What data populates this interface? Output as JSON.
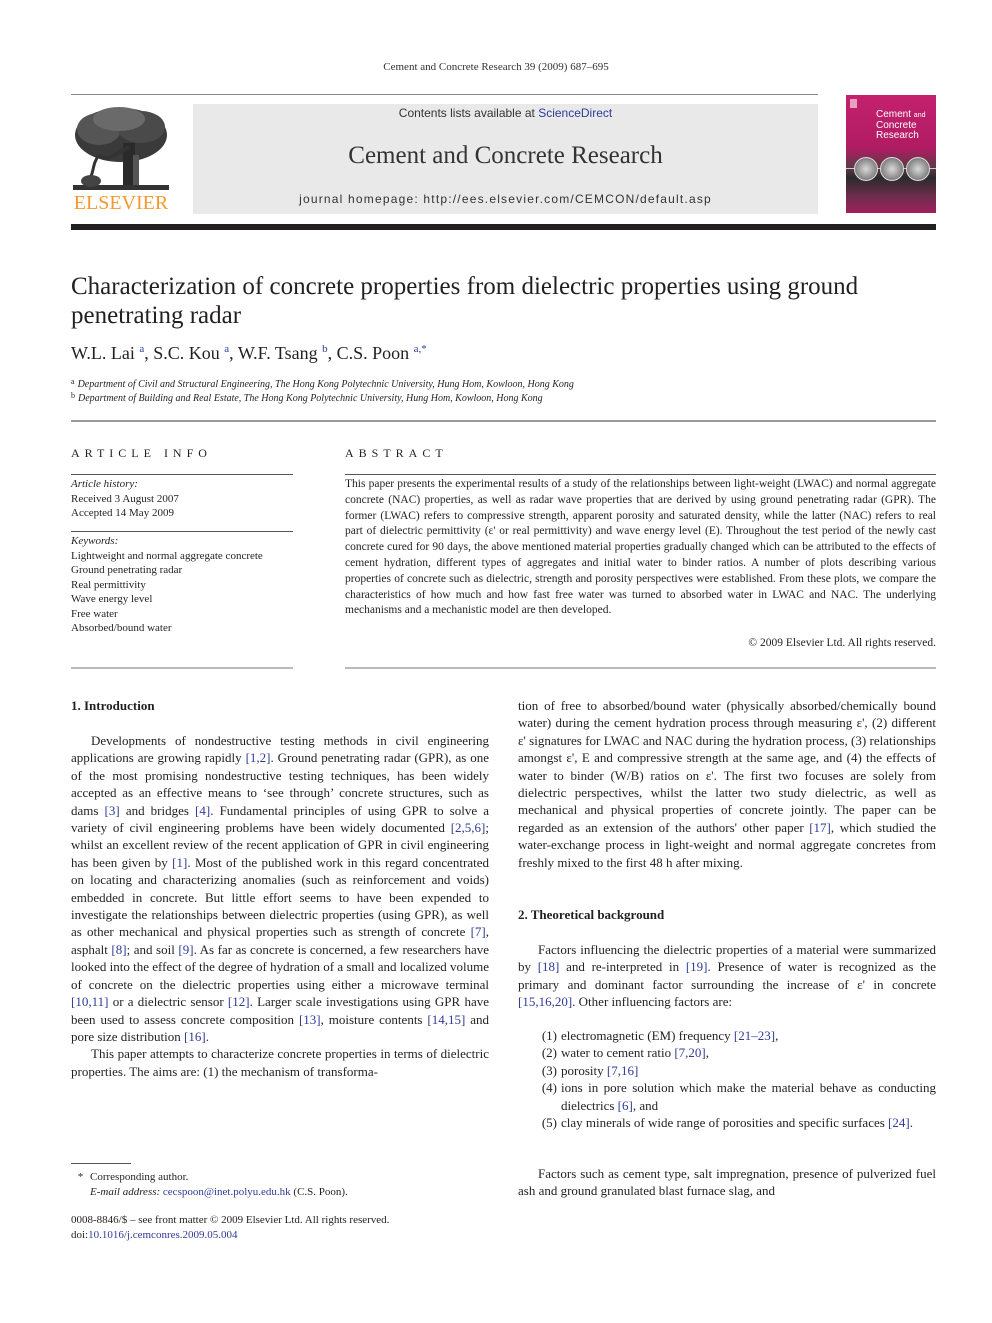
{
  "running_header": "Cement and Concrete Research 39 (2009) 687–695",
  "masthead": {
    "contents_prefix": "Contents lists available at ",
    "contents_link": "ScienceDirect",
    "journal_title": "Cement and Concrete Research",
    "homepage": "journal homepage: http://ees.elsevier.com/CEMCON/default.asp",
    "publisher": "ELSEVIER",
    "cover_title_line1": "Cement",
    "cover_title_and": "and",
    "cover_title_line2": "Concrete",
    "cover_title_line3": "Research"
  },
  "colors": {
    "link": "#2f3b96",
    "publisher_orange": "#f39a2e",
    "masthead_bg": "#e9e9ea",
    "cover_magenta": "#c4206e"
  },
  "article": {
    "title": "Characterization of concrete properties from dielectric properties using ground penetrating radar",
    "authors": [
      {
        "name": "W.L. Lai",
        "sup": "a",
        "sep": ", "
      },
      {
        "name": "S.C. Kou",
        "sup": "a",
        "sep": ", "
      },
      {
        "name": "W.F. Tsang",
        "sup": "b",
        "sep": ", "
      },
      {
        "name": "C.S. Poon",
        "sup": "a,*",
        "sep": ""
      }
    ],
    "affiliations": [
      {
        "key": "a",
        "text": "Department of Civil and Structural Engineering, The Hong Kong Polytechnic University, Hung Hom, Kowloon, Hong Kong"
      },
      {
        "key": "b",
        "text": "Department of Building and Real Estate, The Hong Kong Polytechnic University, Hung Hom, Kowloon, Hong Kong"
      }
    ]
  },
  "article_info": {
    "heading": "ARTICLE INFO",
    "history_label": "Article history:",
    "received": "Received 3 August 2007",
    "accepted": "Accepted 14 May 2009",
    "keywords_label": "Keywords:",
    "keywords": [
      "Lightweight and normal aggregate concrete",
      "Ground penetrating radar",
      "Real permittivity",
      "Wave energy level",
      "Free water",
      "Absorbed/bound water"
    ]
  },
  "abstract": {
    "heading": "ABSTRACT",
    "text": "This paper presents the experimental results of a study of the relationships between light-weight (LWAC) and normal aggregate concrete (NAC) properties, as well as radar wave properties that are derived by using ground penetrating radar (GPR). The former (LWAC) refers to compressive strength, apparent porosity and saturated density, while the latter (NAC) refers to real part of dielectric permittivity (ε' or real permittivity) and wave energy level (E). Throughout the test period of the newly cast concrete cured for 90 days, the above mentioned material properties gradually changed which can be attributed to the effects of cement hydration, different types of aggregates and initial water to binder ratios. A number of plots describing various properties of concrete such as dielectric, strength and porosity perspectives were established. From these plots, we compare the characteristics of how much and how fast free water was turned to absorbed water in LWAC and NAC. The underlying mechanisms and a mechanistic model are then developed.",
    "copyright": "© 2009 Elsevier Ltd. All rights reserved."
  },
  "sections": {
    "intro_heading": "1. Introduction",
    "intro_p1": [
      {
        "t": "Developments of nondestructive testing methods in civil engineering applications are growing rapidly "
      },
      {
        "t": "[1,2]",
        "link": true
      },
      {
        "t": ". Ground penetrating radar (GPR), as one of the most promising nondestructive testing techniques, has been widely accepted as an effective means to ‘see through’ concrete structures, such as dams "
      },
      {
        "t": "[3]",
        "link": true
      },
      {
        "t": " and bridges "
      },
      {
        "t": "[4]",
        "link": true
      },
      {
        "t": ". Fundamental principles of using GPR to solve a variety of civil engineering problems have been widely documented "
      },
      {
        "t": "[2,5,6]",
        "link": true
      },
      {
        "t": "; whilst an excellent review of the recent application of GPR in civil engineering has been given by "
      },
      {
        "t": "[1]",
        "link": true
      },
      {
        "t": ". Most of the published work in this regard concentrated on locating and characterizing anomalies (such as reinforcement and voids) embedded in concrete. But little effort seems to have been expended to investigate the relationships between dielectric properties (using GPR), as well as other mechanical and physical properties such as strength of concrete "
      },
      {
        "t": "[7]",
        "link": true
      },
      {
        "t": ", asphalt "
      },
      {
        "t": "[8]",
        "link": true
      },
      {
        "t": "; and soil "
      },
      {
        "t": "[9]",
        "link": true
      },
      {
        "t": ". As far as concrete is concerned, a few researchers have looked into the effect of the degree of hydration of a small and localized volume of concrete on the dielectric properties using either a microwave terminal "
      },
      {
        "t": "[10,11]",
        "link": true
      },
      {
        "t": " or a dielectric sensor "
      },
      {
        "t": "[12]",
        "link": true
      },
      {
        "t": ". Larger scale investigations using GPR have been used to assess concrete composition "
      },
      {
        "t": "[13]",
        "link": true
      },
      {
        "t": ", moisture contents "
      },
      {
        "t": "[14,15]",
        "link": true
      },
      {
        "t": " and pore size distribution "
      },
      {
        "t": "[16]",
        "link": true
      },
      {
        "t": "."
      }
    ],
    "intro_p2": "This paper attempts to characterize concrete properties in terms of dielectric properties. The aims are: (1) the mechanism of transforma-",
    "col2_p1": [
      {
        "t": "tion of free to absorbed/bound water (physically absorbed/chemically bound water) during the cement hydration process through measuring ε', (2) different ε' signatures for LWAC and NAC during the hydration process, (3) relationships amongst ε', E and compressive strength at the same age, and (4) the effects of water to binder (W/B) ratios on ε'. The first two focuses are solely from dielectric perspectives, whilst the latter two study dielectric, as well as mechanical and physical properties of concrete jointly. The paper can be regarded as an extension of the authors' other paper "
      },
      {
        "t": "[17]",
        "link": true
      },
      {
        "t": ", which studied the water-exchange process in light-weight and normal aggregate concretes from freshly mixed to the first 48 h after mixing."
      }
    ],
    "theory_heading": "2. Theoretical background",
    "theory_p1": [
      {
        "t": "Factors influencing the dielectric properties of a material were summarized by "
      },
      {
        "t": "[18]",
        "link": true
      },
      {
        "t": " and re-interpreted in "
      },
      {
        "t": "[19]",
        "link": true
      },
      {
        "t": ". Presence of water is recognized as the primary and dominant factor surrounding the increase of ε' in concrete "
      },
      {
        "t": "[15,16,20]",
        "link": true
      },
      {
        "t": ". Other influencing factors are:"
      }
    ],
    "factors": [
      {
        "num": "(1)",
        "parts": [
          {
            "t": "electromagnetic (EM) frequency "
          },
          {
            "t": "[21–23]",
            "link": true
          },
          {
            "t": ","
          }
        ]
      },
      {
        "num": "(2)",
        "parts": [
          {
            "t": "water to cement ratio "
          },
          {
            "t": "[7,20]",
            "link": true
          },
          {
            "t": ","
          }
        ]
      },
      {
        "num": "(3)",
        "parts": [
          {
            "t": "porosity "
          },
          {
            "t": "[7,16]",
            "link": true
          }
        ]
      },
      {
        "num": "(4)",
        "parts": [
          {
            "t": "ions in pore solution which make the material behave as conducting dielectrics "
          },
          {
            "t": "[6]",
            "link": true
          },
          {
            "t": ", and"
          }
        ]
      },
      {
        "num": "(5)",
        "parts": [
          {
            "t": "clay minerals of wide range of porosities and specific surfaces "
          },
          {
            "t": "[24]",
            "link": true
          },
          {
            "t": "."
          }
        ]
      }
    ],
    "theory_p2": "Factors such as cement type, salt impregnation, presence of pulverized fuel ash and ground granulated blast furnace slag, and"
  },
  "footnotes": {
    "star": "*",
    "corresponding": "Corresponding author.",
    "email_label": "E-mail address:",
    "email": "cecspoon@inet.polyu.edu.hk",
    "email_suffix": " (C.S. Poon).",
    "front_matter": "0008-8846/$ – see front matter © 2009 Elsevier Ltd. All rights reserved.",
    "doi_label": "doi:",
    "doi": "10.1016/j.cemconres.2009.05.004"
  }
}
